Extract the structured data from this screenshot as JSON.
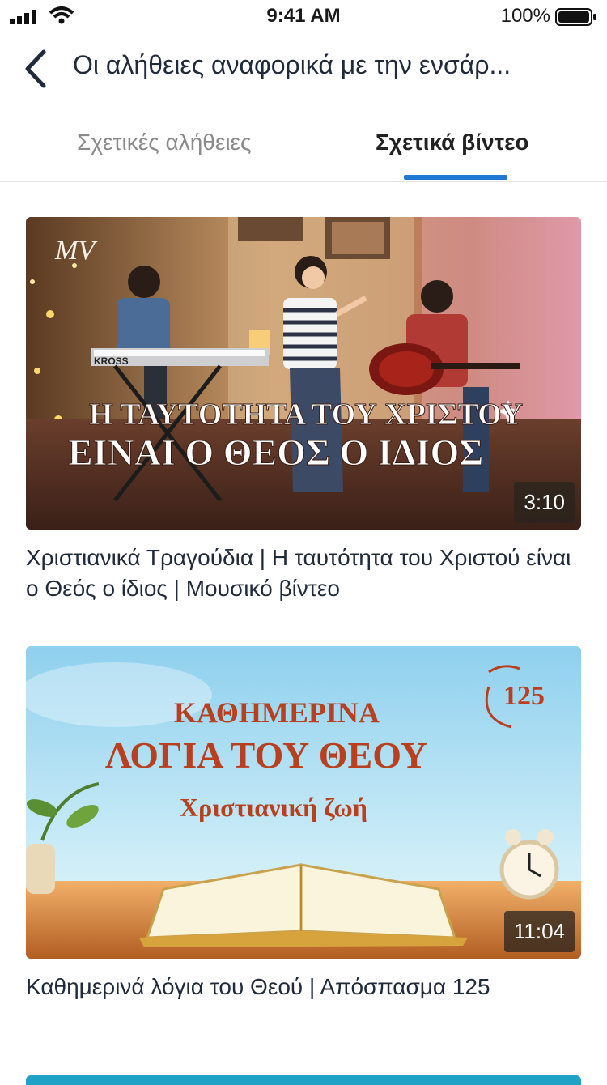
{
  "status_bar": {
    "time": "9:41 AM",
    "battery": "100%"
  },
  "header": {
    "title": "Οι αλήθειες αναφορικά με την ενσάρ..."
  },
  "tabs": [
    {
      "label": "Σχετικές αλήθειες",
      "active": false
    },
    {
      "label": "Σχετικά βίντεο",
      "active": true
    }
  ],
  "videos": [
    {
      "title": "Χριστιανικά Τραγούδια | Η ταυτότητα του Χριστού είναι ο Θεός ο ίδιος | Μουσικό βίντεο",
      "duration": "3:10",
      "thumbnail_text": {
        "badge": "MV",
        "keyboard_brand": "KROSS",
        "line1": "Η ΤΑΥΤΟΤΗΤΑ ΤΟΥ ΧΡΙΣΤΟΥ",
        "line2": "ΕΙΝΑΙ Ο ΘΕΟΣ Ο ΙΔΙΟΣ"
      }
    },
    {
      "title": "Καθημερινά λόγια του Θεού | Απόσπασμα 125",
      "duration": "11:04",
      "thumbnail_text": {
        "line1": "ΚΑΘΗΜΕΡΙΝΑ",
        "line2": "ΛΟΓΙΑ ΤΟΥ ΘΕΟΥ",
        "line3": "Χριστιανική ζωή",
        "badge": "125"
      }
    }
  ],
  "colors": {
    "accent": "#1e78d6",
    "thumb_title": "#b9401f",
    "peek_card": "#1fa2c6"
  }
}
